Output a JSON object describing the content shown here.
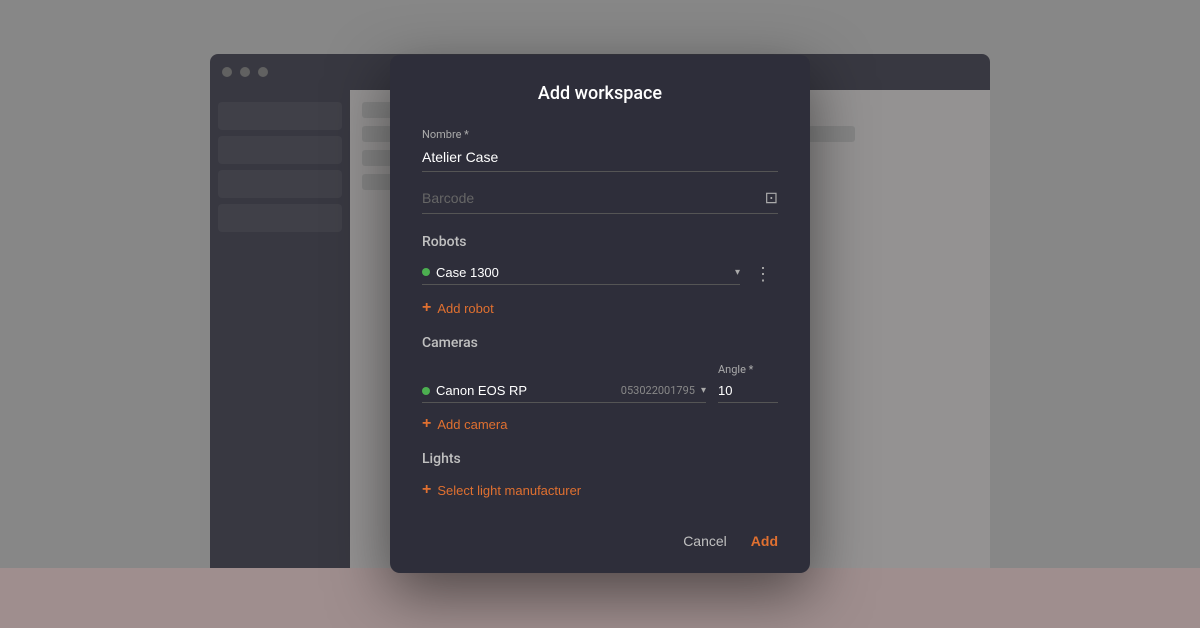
{
  "background": {
    "color": "#d0d0d0"
  },
  "modal": {
    "title": "Add workspace",
    "name_label": "Nombre *",
    "name_value": "Atelier Case",
    "barcode_placeholder": "Barcode",
    "robots_section": "Robots",
    "robot_name": "Case 1300",
    "add_robot_label": "Add robot",
    "cameras_section": "Cameras",
    "camera_name": "Canon EOS RP",
    "camera_id": "053022001795",
    "angle_label": "Angle *",
    "angle_value": "10",
    "add_camera_label": "Add camera",
    "lights_section": "Lights",
    "select_light_label": "Select light manufacturer",
    "cancel_label": "Cancel",
    "add_label": "Add"
  }
}
